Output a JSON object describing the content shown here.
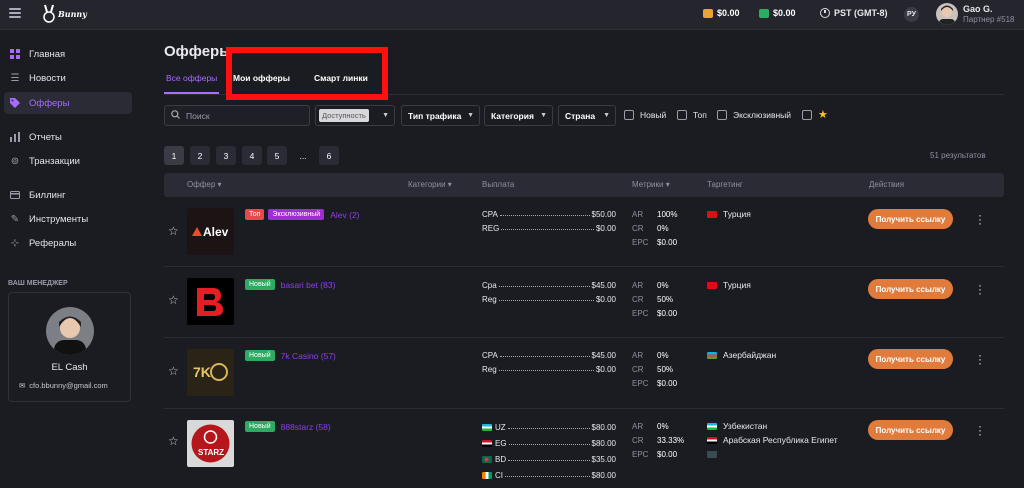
{
  "topbar": {
    "logo_text": "Bunny",
    "balance1": "$0.00",
    "balance2": "$0.00",
    "timezone": "PST (GMT-8)",
    "lang": "РУ",
    "user_name": "Gao G.",
    "user_sub": "Партнер #518",
    "colors": {
      "wallet1": "#e8a33a",
      "wallet2": "#2dab62"
    }
  },
  "sidebar": {
    "items": [
      {
        "label": "Главная",
        "icon": "dashboard-icon"
      },
      {
        "label": "Новости",
        "icon": "news-icon"
      },
      {
        "label": "Офферы",
        "icon": "tag-icon",
        "active": true
      },
      {
        "label": "Отчеты",
        "icon": "bar-chart-icon"
      },
      {
        "label": "Транзакции",
        "icon": "transactions-icon"
      },
      {
        "label": "Биллинг",
        "icon": "card-icon"
      },
      {
        "label": "Инструменты",
        "icon": "wrench-icon"
      },
      {
        "label": "Рефералы",
        "icon": "referral-icon"
      }
    ],
    "manager_title": "ВАШ МЕНЕДЖЕР",
    "manager_name": "EL Cash",
    "manager_email": "cfo.bbunny@gmail.com"
  },
  "page": {
    "title": "Офферы",
    "tabs": [
      "Все офферы",
      "Мои офферы",
      "Смарт линки"
    ],
    "accent": "#a76bff"
  },
  "filters": {
    "search_placeholder": "Поиск",
    "availability": "Доступность",
    "traffic_type": "Тип трафика",
    "category": "Категория",
    "country": "Страна",
    "new": "Новый",
    "top": "Топ",
    "exclusive": "Эксклюзивный"
  },
  "pagination": {
    "pages": [
      "1",
      "2",
      "3",
      "4",
      "5",
      "...",
      "6"
    ],
    "results": "51 результатов"
  },
  "table": {
    "headers": {
      "offer": "Оффер",
      "categories": "Категории",
      "payout": "Выплата",
      "metrics": "Метрики",
      "targeting": "Таргетинг",
      "actions": "Действия"
    },
    "get_link": "Получить ссылку",
    "rows": [
      {
        "logo": "alev-logo",
        "logo_text": "Alev",
        "badges": [
          "Топ",
          "Эксклюзивный"
        ],
        "name": "Alev (2)",
        "payouts": [
          [
            "CPA",
            "$50.00"
          ],
          [
            "REG",
            "$0.00"
          ]
        ],
        "metrics": [
          [
            "AR",
            "100%"
          ],
          [
            "CR",
            "0%"
          ],
          [
            "EPC",
            "$0.00"
          ]
        ],
        "targeting": [
          "Турция"
        ]
      },
      {
        "logo": "basari-bet-logo",
        "badges": [
          "Новый"
        ],
        "name": "basari bet (83)",
        "payouts": [
          [
            "Cpa",
            "$45.00"
          ],
          [
            "Reg",
            "$0.00"
          ]
        ],
        "metrics": [
          [
            "AR",
            "0%"
          ],
          [
            "CR",
            "50%"
          ],
          [
            "EPC",
            "$0.00"
          ]
        ],
        "targeting": [
          "Турция"
        ]
      },
      {
        "logo": "7k-casino-logo",
        "logo_text": "7K",
        "badges": [
          "Новый"
        ],
        "name": "7k Casino (57)",
        "payouts": [
          [
            "CPA",
            "$45.00"
          ],
          [
            "Reg",
            "$0.00"
          ]
        ],
        "metrics": [
          [
            "AR",
            "0%"
          ],
          [
            "CR",
            "50%"
          ],
          [
            "EPC",
            "$0.00"
          ]
        ],
        "targeting": [
          "Азербайджан"
        ]
      },
      {
        "logo": "888starz-logo",
        "logo_text": "STARZ",
        "badges": [
          "Новый"
        ],
        "name": "888starz (58)",
        "payouts": [
          [
            "UZ",
            "$80.00"
          ],
          [
            "EG",
            "$80.00"
          ],
          [
            "BD",
            "$35.00"
          ],
          [
            "CI",
            "$80.00"
          ]
        ],
        "metrics": [
          [
            "AR",
            "0%"
          ],
          [
            "CR",
            "33.33%"
          ],
          [
            "EPC",
            "$0.00"
          ]
        ],
        "targeting": [
          "Узбекистан",
          "Арабская Республика Египет"
        ]
      }
    ]
  }
}
